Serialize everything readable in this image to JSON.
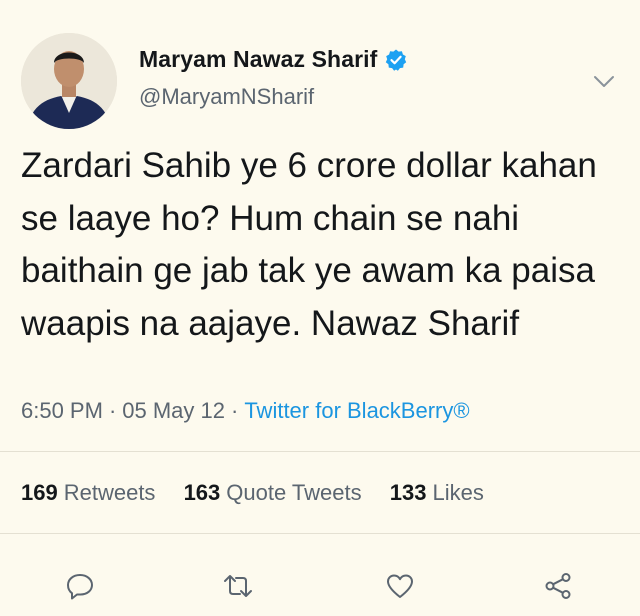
{
  "author": {
    "display_name": "Maryam Nawaz Sharif",
    "handle": "@MaryamNSharif",
    "verified": true,
    "avatar_icon": "profile-photo"
  },
  "tweet": {
    "text": "Zardari Sahib ye 6 crore dollar kahan se laaye ho? Hum chain se nahi baithain ge jab tak ye awam ka paisa waapis na aajaye. Nawaz Sharif",
    "time": "6:50 PM",
    "separator": "·",
    "date": "05 May 12",
    "source": "Twitter for BlackBerry®"
  },
  "stats": {
    "retweets_count": "169",
    "retweets_label": "Retweets",
    "quotes_count": "163",
    "quotes_label": "Quote Tweets",
    "likes_count": "133",
    "likes_label": "Likes"
  },
  "actions": [
    "reply-icon",
    "retweet-icon",
    "like-icon",
    "share-icon"
  ],
  "colors": {
    "background": "#fdfaee",
    "link": "#1b95e0",
    "verified": "#1da1f2",
    "secondary_text": "#5b6570",
    "icon": "#5b6570"
  }
}
